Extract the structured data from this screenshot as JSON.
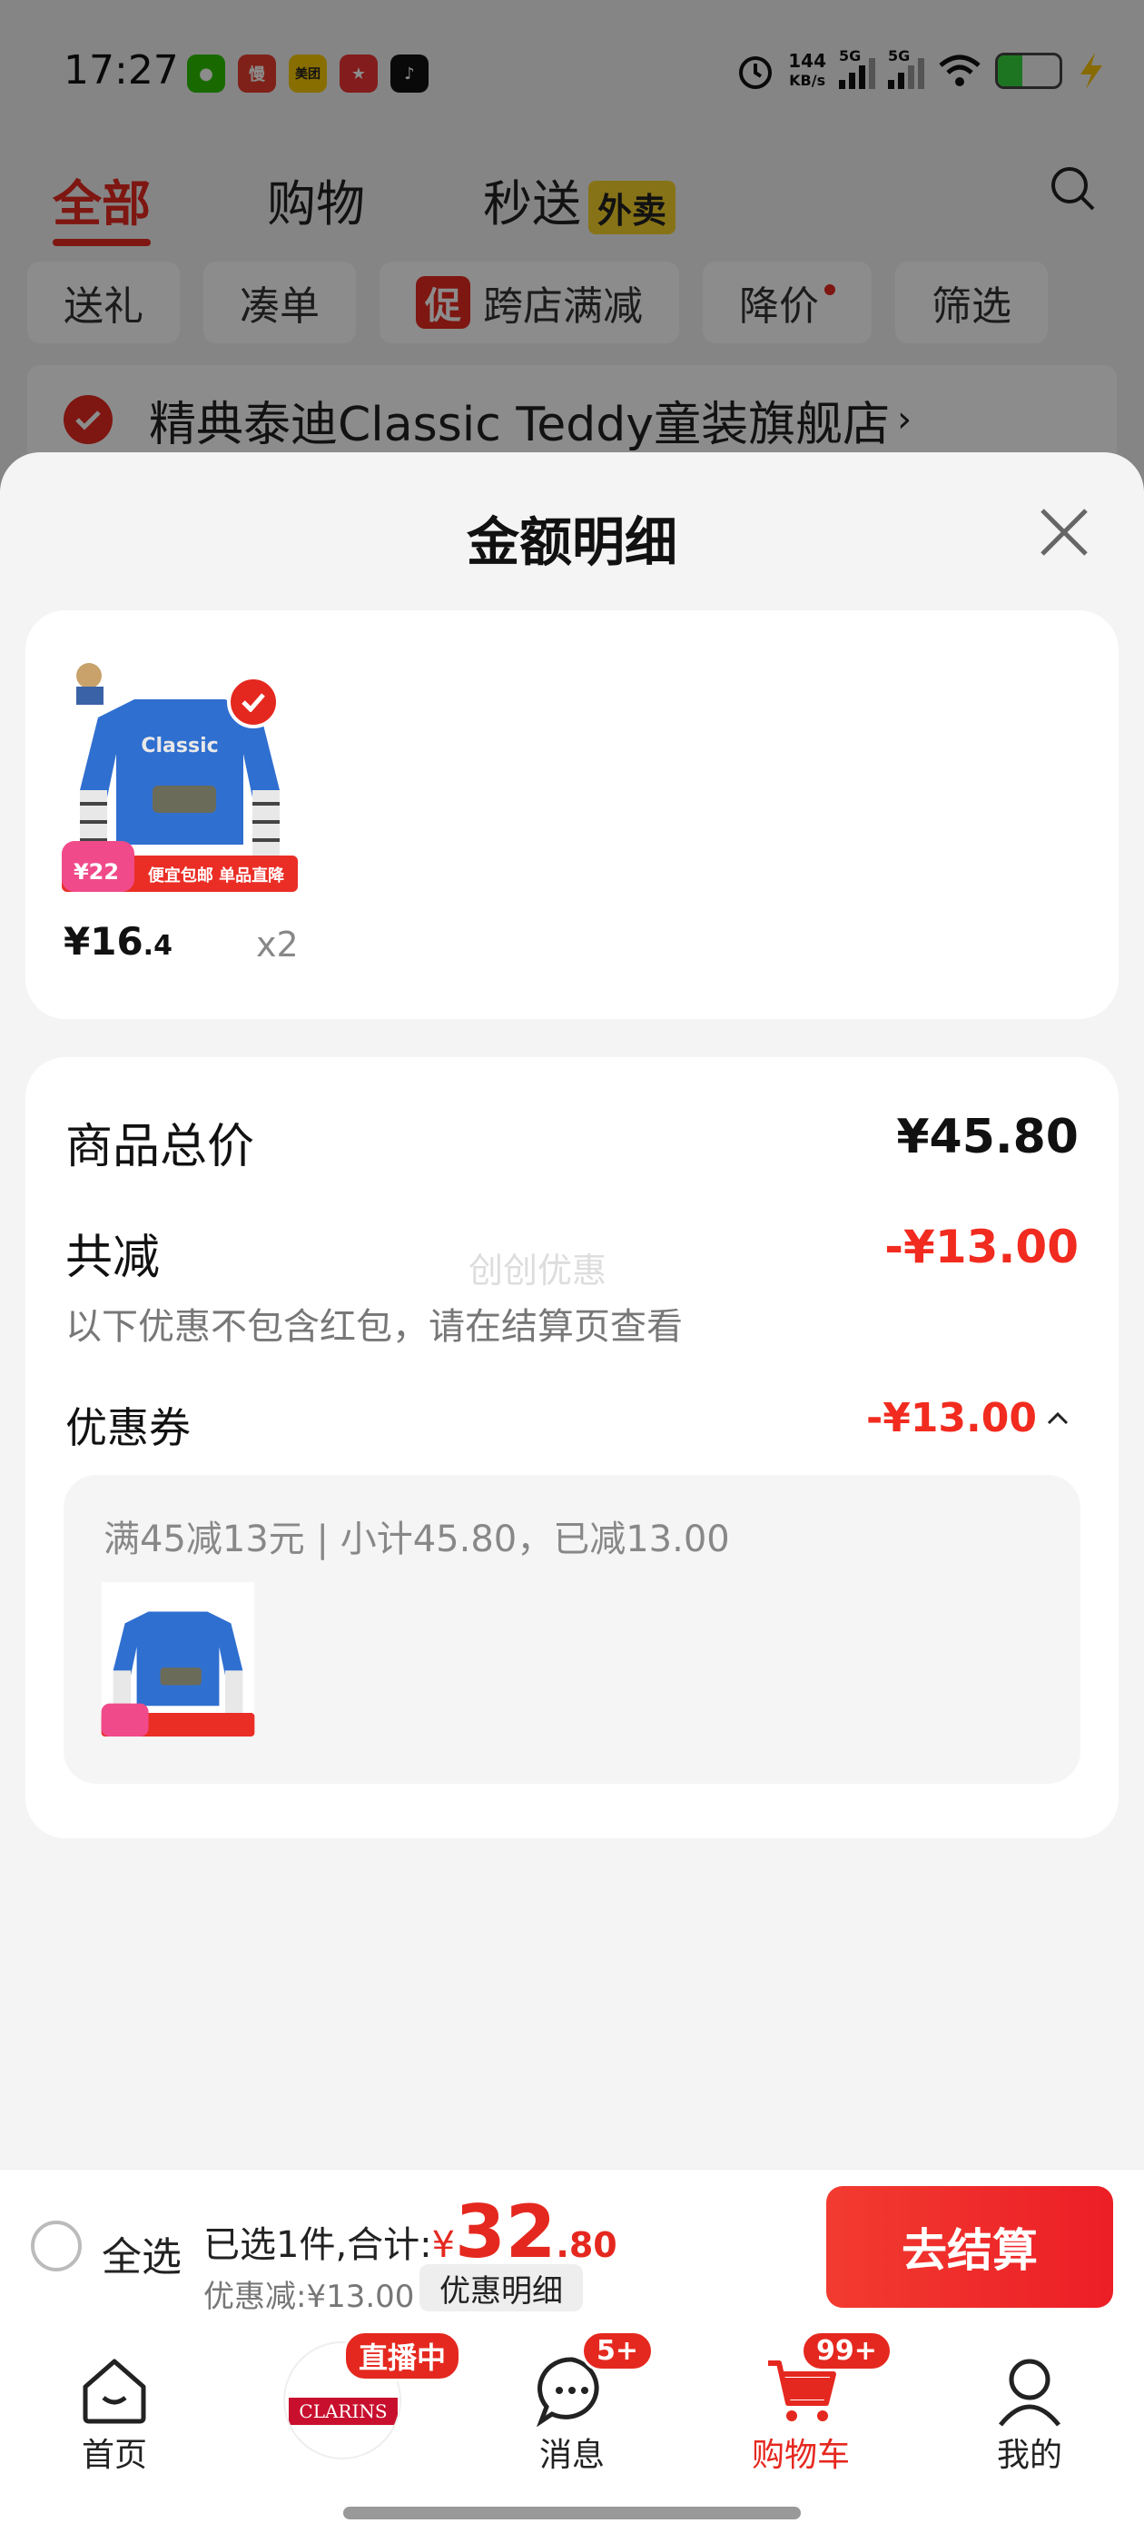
{
  "status_bar": {
    "time": "17:27",
    "apps": [
      {
        "icon": "wechat-icon",
        "label": "",
        "color": "#2dc100"
      },
      {
        "icon": "slow-app-icon",
        "label": "慢",
        "color": "#e73c2e"
      },
      {
        "icon": "meituan-icon",
        "label": "美团",
        "color": "#f8c800"
      },
      {
        "icon": "red-app-icon",
        "label": "",
        "color": "#e33"
      },
      {
        "icon": "tiktok-icon",
        "label": "",
        "color": "#111"
      }
    ],
    "net_speed_value": "144",
    "net_speed_unit": "KB/s",
    "signal1": "5G",
    "signal2": "5G"
  },
  "header": {
    "tabs": [
      "全部",
      "购物",
      "秒送"
    ],
    "takeout_badge": "外卖"
  },
  "chips": {
    "gift": "送礼",
    "combine": "凑单",
    "promo_tag": "促",
    "cross_store": "跨店满减",
    "price_drop": "降价",
    "filter": "筛选"
  },
  "store": {
    "name": "精典泰迪Classic Teddy童装旗舰店",
    "arrow": "›"
  },
  "sheet": {
    "title": "金额明细",
    "product": {
      "price_int": "¥16",
      "price_dec": ".4",
      "quantity": "x2",
      "promo_text": "便宜包邮 单品直降",
      "promo_price": "¥22",
      "shirt_text": "Classic"
    },
    "total_label": "商品总价",
    "total_value": "¥45.80",
    "discount_label": "共减",
    "discount_value": "-¥13.00",
    "discount_note": "以下优惠不包含红包，请在结算页查看",
    "watermark": "创创优惠",
    "coupon_label": "优惠券",
    "coupon_value": "-¥13.00",
    "coupon_rule": "满45减13元 | 小计45.80，已减13.00"
  },
  "bottom_bar": {
    "select_all": "全选",
    "summary_prefix": "已选1件,合计:",
    "currency": "¥",
    "total_int": "32",
    "total_dec": ".80",
    "saved": "优惠减:¥13.00",
    "detail_button": "优惠明细",
    "checkout": "去结算"
  },
  "nav": {
    "home": "首页",
    "live_badge": "直播中",
    "live_logo": "CLARINS",
    "messages": "消息",
    "messages_badge": "5+",
    "cart": "购物车",
    "cart_badge": "99+",
    "mine": "我的"
  },
  "colors": {
    "accent": "#e5281f",
    "price_red": "#f12b1f"
  }
}
